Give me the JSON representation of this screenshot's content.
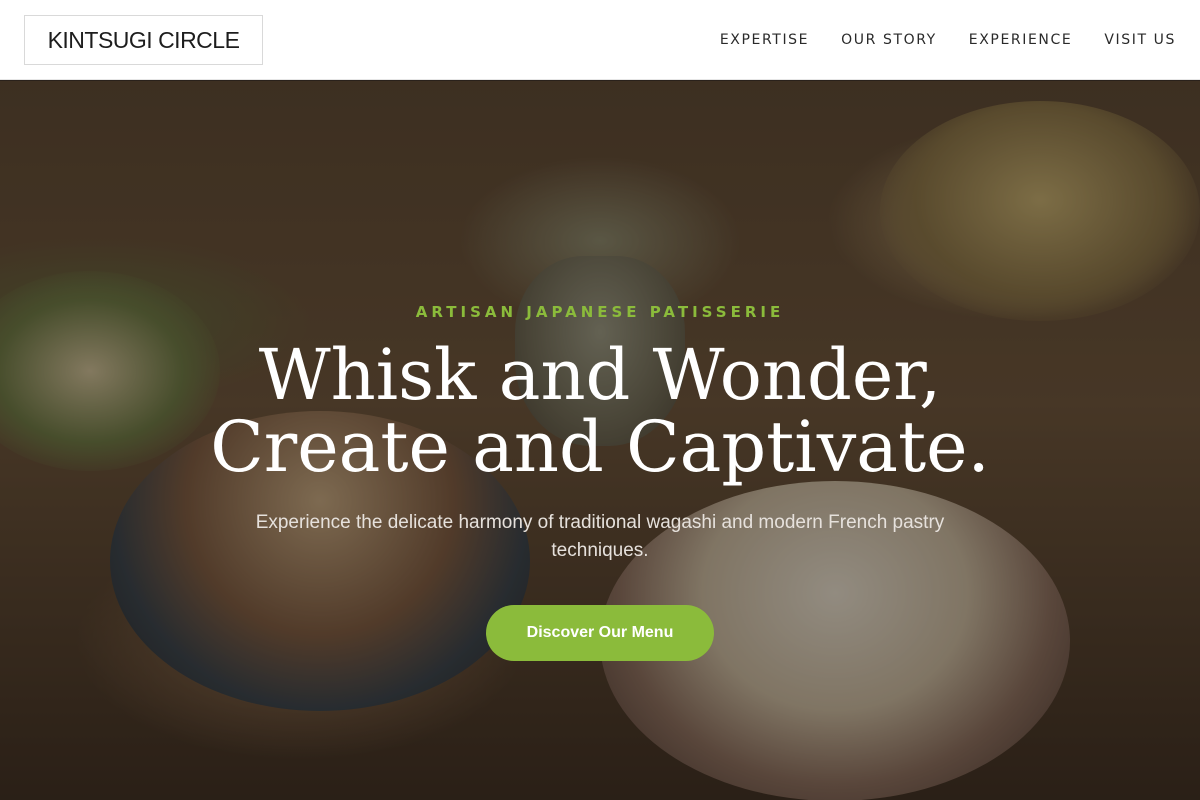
{
  "header": {
    "logo": "KINTSUGI CIRCLE",
    "nav": [
      "EXPERTISE",
      "OUR STORY",
      "EXPERIENCE",
      "VISIT US"
    ]
  },
  "hero": {
    "eyebrow": "ARTISAN JAPANESE PATISSERIE",
    "headline_line1": "Whisk and Wonder,",
    "headline_line2": "Create and Captivate.",
    "subtitle": "Experience the delicate harmony of traditional wagashi and modern French pastry techniques.",
    "cta_label": "Discover Our Menu"
  },
  "colors": {
    "accent": "#8bbb3b",
    "header_bg": "#ffffff",
    "nav_text": "#2a2a2a"
  }
}
